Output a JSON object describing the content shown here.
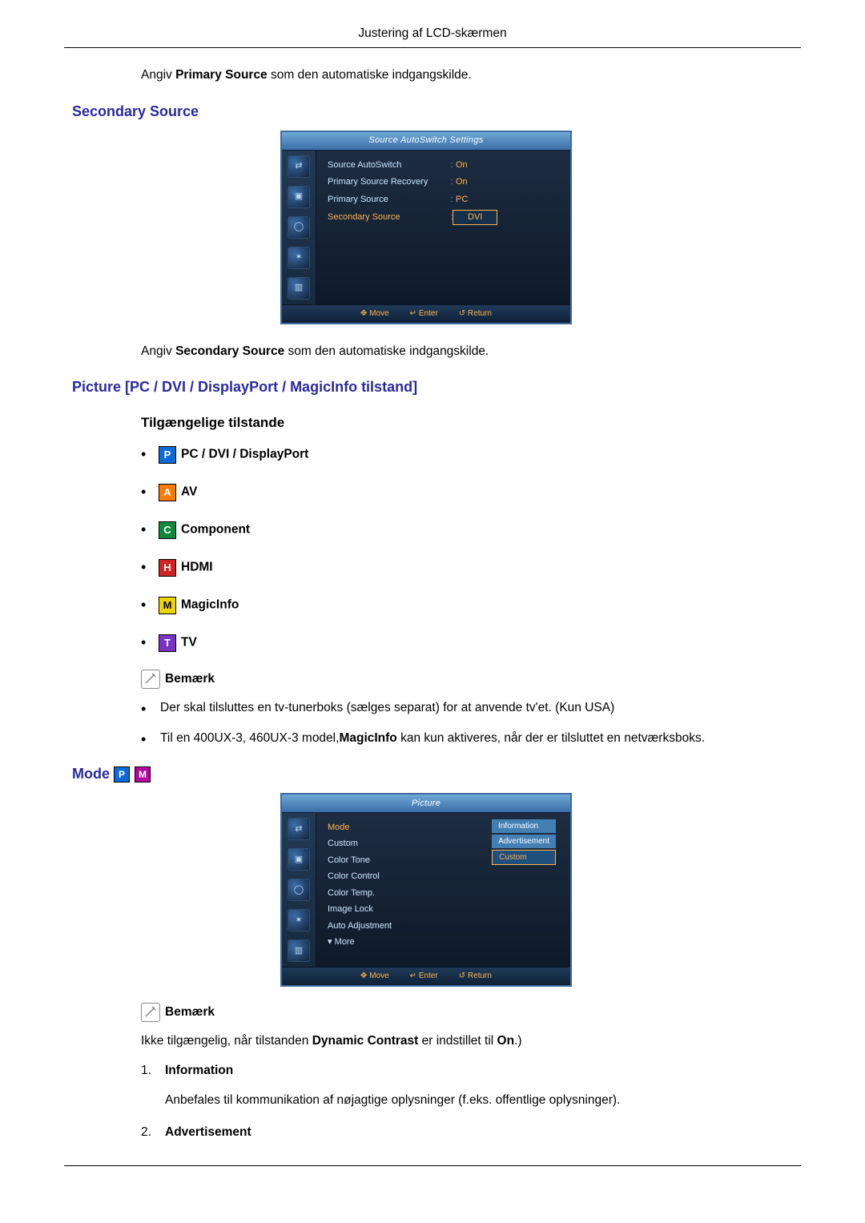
{
  "pageHeader": "Justering af LCD-skærmen",
  "para_primary": {
    "pre": "Angiv ",
    "bold": "Primary Source",
    "post": " som den automatiske indgangskilde."
  },
  "sec_secondary_title": "Secondary Source",
  "osd1": {
    "title": "Source AutoSwitch Settings",
    "r1k": "Source AutoSwitch",
    "r1v": "On",
    "r2k": "Primary Source Recovery",
    "r2v": "On",
    "r3k": "Primary Source",
    "r3v": "PC",
    "r4k": "Secondary Source",
    "r4v": "DVI",
    "foot_move": "Move",
    "foot_enter": "Enter",
    "foot_return": "Return"
  },
  "para_secondary": {
    "pre": "Angiv ",
    "bold": "Secondary Source",
    "post": " som den automatiske indgangskilde."
  },
  "sec_picture_title": "Picture [PC / DVI / DisplayPort / MagicInfo tilstand]",
  "sub_modes_title": "Tilgængelige tilstande",
  "modes": {
    "p": "PC / DVI / DisplayPort",
    "a": "AV",
    "c": "Component",
    "h": "HDMI",
    "m": "MagicInfo",
    "t": "TV"
  },
  "note_label": "Bemærk",
  "notes_picture": {
    "n1": "Der skal tilsluttes en tv-tunerboks (sælges separat) for at anvende tv'et. (Kun USA)",
    "n2_pre": "Til en 400UX-3, 460UX-3 model,",
    "n2_bold": "MagicInfo",
    "n2_post": " kan kun aktiveres, når der er tilsluttet en netværksboks."
  },
  "sec_mode_title": "Mode",
  "osd2": {
    "title": "Picture",
    "items": {
      "mode": "Mode",
      "custom": "Custom",
      "colortone": "Color Tone",
      "colorcontrol": "Color Control",
      "colortemp": "Color Temp.",
      "imagelock": "Image Lock",
      "autoadj": "Auto Adjustment",
      "more": "▾ More"
    },
    "vals": {
      "info": "Information",
      "adv": "Advertisement",
      "cust": "Custom"
    },
    "foot_move": "Move",
    "foot_enter": "Enter",
    "foot_return": "Return"
  },
  "note_mode": {
    "pre": "Ikke tilgængelig, når tilstanden ",
    "bold": "Dynamic Contrast",
    "mid": " er indstillet til ",
    "bold2": "On",
    "post": ".)"
  },
  "numlist": {
    "i1_title": "Information",
    "i1_desc": "Anbefales til kommunikation af nøjagtige oplysninger (f.eks. offentlige oplysninger).",
    "i2_title": "Advertisement"
  }
}
